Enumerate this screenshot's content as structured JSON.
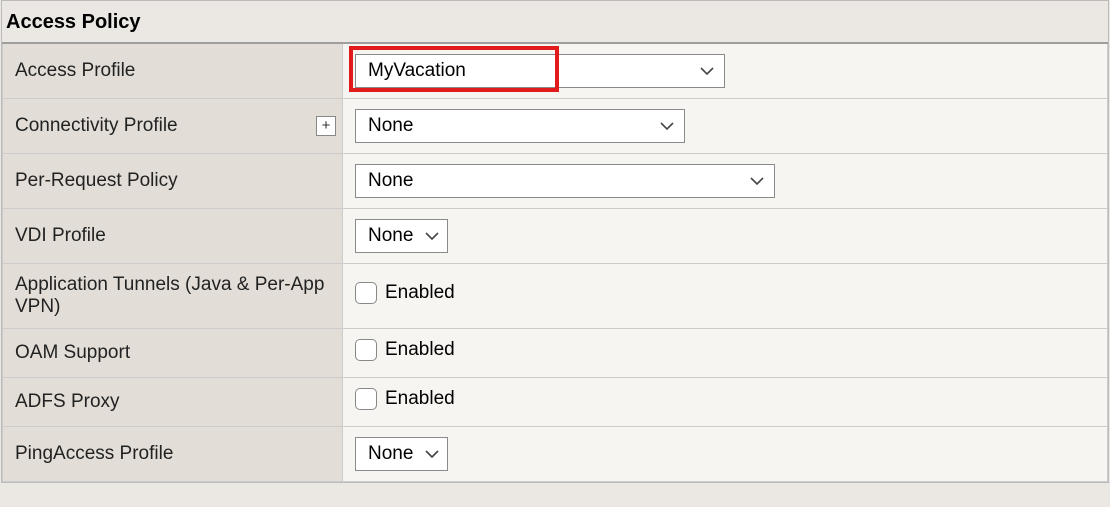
{
  "panel": {
    "title": "Access Policy"
  },
  "rows": {
    "access_profile": {
      "label": "Access Profile",
      "value": "MyVacation"
    },
    "connectivity_profile": {
      "label": "Connectivity Profile",
      "value": "None",
      "plus": "+"
    },
    "per_request_policy": {
      "label": "Per-Request Policy",
      "value": "None"
    },
    "vdi_profile": {
      "label": "VDI Profile",
      "value": "None"
    },
    "app_tunnels": {
      "label": "Application Tunnels (Java & Per-App VPN)",
      "checkbox_label": "Enabled"
    },
    "oam_support": {
      "label": "OAM Support",
      "checkbox_label": "Enabled"
    },
    "adfs_proxy": {
      "label": "ADFS Proxy",
      "checkbox_label": "Enabled"
    },
    "pingaccess_profile": {
      "label": "PingAccess Profile",
      "value": "None"
    }
  }
}
